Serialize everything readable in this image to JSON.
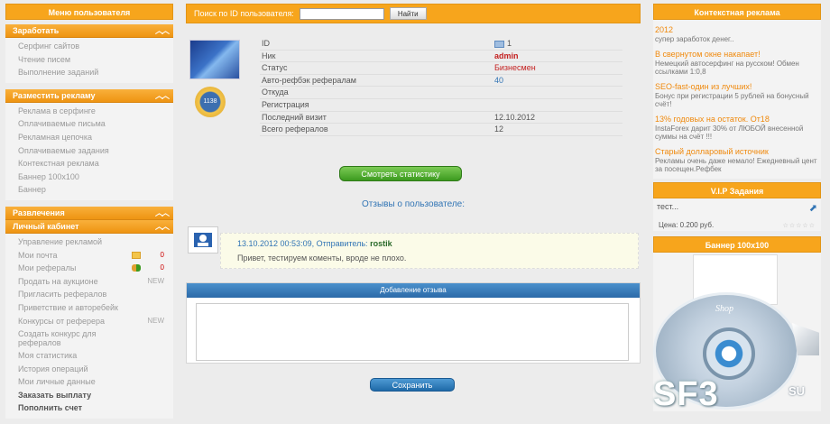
{
  "left_menu": {
    "title": "Меню пользователя",
    "sections": [
      {
        "title": "Заработать",
        "items": [
          {
            "label": "Серфинг сайтов"
          },
          {
            "label": "Чтение писем"
          },
          {
            "label": "Выполнение заданий"
          }
        ]
      },
      {
        "title": "Разместить рекламу",
        "items": [
          {
            "label": "Реклама в серфинге"
          },
          {
            "label": "Оплачиваемые письма"
          },
          {
            "label": "Рекламная цепочка"
          },
          {
            "label": "Оплачиваемые задания"
          },
          {
            "label": "Контекстная реклама"
          },
          {
            "label": "Баннер 100х100"
          },
          {
            "label": "Баннер"
          }
        ]
      },
      {
        "title": "Развлечения",
        "items": []
      },
      {
        "title": "Личный кабинет",
        "items": [
          {
            "label": "Управление рекламой"
          },
          {
            "label": "Мои почта",
            "count": "0",
            "icon": "mail-icon"
          },
          {
            "label": "Мои рефералы",
            "count": "0",
            "icon": "users-icon"
          },
          {
            "label": "Продать на аукционе",
            "tag": "NEW"
          },
          {
            "label": "Пригласить рефералов"
          },
          {
            "label": "Приветствие и авторебейк"
          },
          {
            "label": "Конкурсы от реферера",
            "tag": "NEW"
          },
          {
            "label": "Создать конкурс для рефералов"
          },
          {
            "label": "Моя статистика"
          },
          {
            "label": "История операций"
          },
          {
            "label": "Мои личные данные"
          },
          {
            "label": "Заказать выплату",
            "bold": true
          },
          {
            "label": "Пополнить счет",
            "bold": true
          }
        ]
      }
    ],
    "chevrons": "︿︿"
  },
  "search": {
    "label": "Поиск по ID пользователя:",
    "value": "",
    "button": "Найти"
  },
  "profile": {
    "badge_value": "1138",
    "rows": [
      {
        "key": "ID",
        "value": "1"
      },
      {
        "key": "Ник",
        "value": "admin"
      },
      {
        "key": "Статус",
        "value": "Бизнесмен"
      },
      {
        "key": "Авто-рефбэк рефералам",
        "value": "40"
      },
      {
        "key": "Откуда",
        "value": ""
      },
      {
        "key": "Регистрация",
        "value": ""
      },
      {
        "key": "Последний визит",
        "value": "12.10.2012"
      },
      {
        "key": "Всего рефералов",
        "value": "12"
      }
    ],
    "stats_button": "Смотреть статистику"
  },
  "reviews": {
    "title": "Отзывы о пользователе:",
    "items": [
      {
        "datetime": "13.10.2012 00:53:09, Отправитель:",
        "sender": "rostik",
        "text": "Привет, тестируем коменты, вроде не плохо."
      }
    ],
    "add_title": "Добавление отзыва",
    "textarea_value": "",
    "save_button": "Сохранить"
  },
  "right": {
    "context_title": "Контекстная реклама",
    "ads": [
      {
        "title": "2012",
        "desc": "супер заработок денег.."
      },
      {
        "title": "В свернутом окне накапает!",
        "desc": "Немецкий автосерфинг на русском! Обмен ссылками 1:0,8"
      },
      {
        "title": "SEO-fast-один из лучших!",
        "desc": "Бонус при регистрации 5 рублей на бонусный счёт!"
      },
      {
        "title": "13% годовых на остаток. От18",
        "desc": "InstaForex дарит 30% от ЛЮБОЙ внесенной суммы на счёт !!!"
      },
      {
        "title": "Старый долларовый источник",
        "desc": "Рекламы очень даже немало! Ежедневный цент за посещен.Рефбек"
      }
    ],
    "vip_title": "V.I.P Задания",
    "vip_text": "тест...",
    "vip_price": "Цена: 0.200 руб.",
    "vip_dots": "☆☆☆☆☆",
    "banner_title": "Баннер 100х100",
    "logo_shop": "Shop",
    "logo_main": "SF3",
    "logo_su": "SU"
  },
  "colors": {
    "orange": "#f7a51c",
    "link_blue": "#3275b5",
    "status_red": "#c42020",
    "green_button": "#3c9a1f",
    "blue_button": "#1f6aa8"
  }
}
